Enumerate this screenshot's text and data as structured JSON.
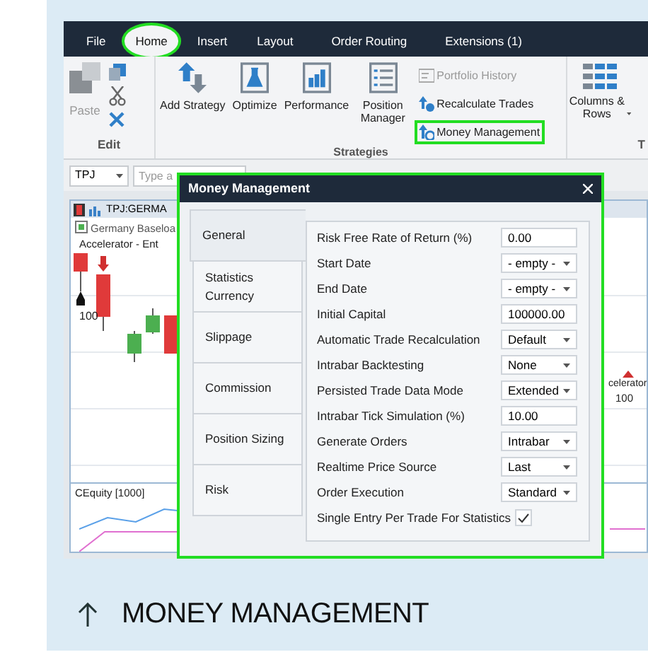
{
  "ribbon": {
    "tabs": [
      {
        "label": "File",
        "selected": false,
        "highlighted": false
      },
      {
        "label": "Home",
        "selected": true,
        "highlighted": true
      },
      {
        "label": "Insert",
        "selected": false,
        "highlighted": false
      },
      {
        "label": "Layout",
        "selected": false,
        "highlighted": false
      },
      {
        "label": "Order Routing",
        "selected": false,
        "highlighted": false
      },
      {
        "label": "Extensions (1)",
        "selected": false,
        "highlighted": false
      }
    ],
    "edit_group": {
      "title": "Edit",
      "paste": {
        "label": "Paste",
        "disabled": true
      }
    },
    "strategies_group": {
      "title": "Strategies",
      "large_buttons": [
        "Add Strategy",
        "Optimize",
        "Performance",
        "Position Manager"
      ],
      "small_buttons": [
        {
          "label": "Portfolio History",
          "disabled": true,
          "highlighted": false
        },
        {
          "label": "Recalculate Trades",
          "disabled": false,
          "highlighted": false
        },
        {
          "label": "Money Management",
          "disabled": false,
          "highlighted": true
        }
      ]
    },
    "columns_group": {
      "label": "Columns & Rows",
      "next_group_title": "T"
    }
  },
  "toolbar": {
    "symbol": "TPJ",
    "search_placeholder": "Type a"
  },
  "chart": {
    "window_title": "TPJ:GERMA",
    "series_label": "Germany Baseloa",
    "indicator_label": "Accelerator - Ent",
    "price_label": "100",
    "right_labels": [
      "celerator",
      "100"
    ],
    "equity_label": "CEquity  [1000]"
  },
  "dialog": {
    "title": "Money Management",
    "highlighted": true,
    "tabs": [
      {
        "label": "General",
        "selected": true
      },
      {
        "label": "Statistics Currency",
        "selected": false
      },
      {
        "label": "Slippage",
        "selected": false
      },
      {
        "label": "Commission",
        "selected": false
      },
      {
        "label": "Position Sizing",
        "selected": false
      },
      {
        "label": "Risk",
        "selected": false
      }
    ],
    "properties": [
      {
        "label": "Risk Free Rate of Return (%)",
        "kind": "text",
        "value": "0.00"
      },
      {
        "label": "Start Date",
        "kind": "dropdown",
        "value": "- empty -"
      },
      {
        "label": "End Date",
        "kind": "dropdown",
        "value": "- empty -"
      },
      {
        "label": "Initial Capital",
        "kind": "text",
        "value": "100000.00"
      },
      {
        "label": "Automatic Trade Recalculation",
        "kind": "dropdown",
        "value": "Default"
      },
      {
        "label": "Intrabar Backtesting",
        "kind": "dropdown",
        "value": "None"
      },
      {
        "label": "Persisted Trade Data Mode",
        "kind": "dropdown",
        "value": "Extended"
      },
      {
        "label": "Intrabar Tick Simulation (%)",
        "kind": "text",
        "value": "10.00"
      },
      {
        "label": "Generate Orders",
        "kind": "dropdown",
        "value": "Intrabar"
      },
      {
        "label": "Realtime Price Source",
        "kind": "dropdown",
        "value": "Last"
      },
      {
        "label": "Order Execution",
        "kind": "dropdown",
        "value": "Standard"
      },
      {
        "label": "Single Entry Per Trade For Statistics",
        "kind": "checkbox",
        "checked": true
      }
    ]
  },
  "caption": {
    "title": "MONEY MANAGEMENT"
  }
}
